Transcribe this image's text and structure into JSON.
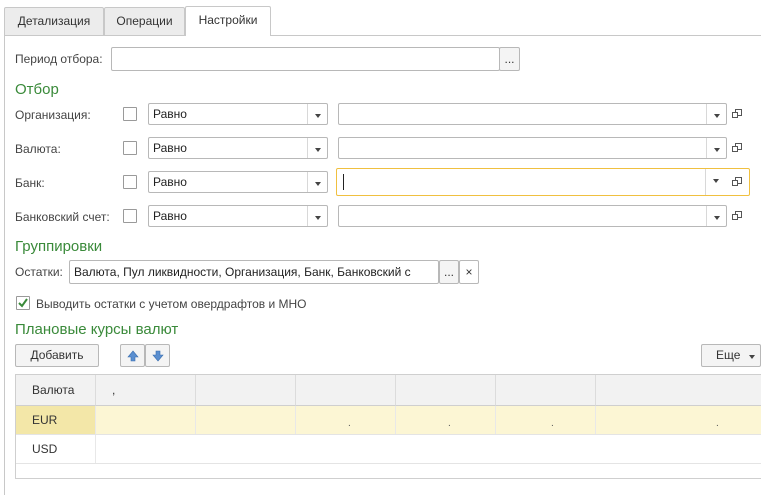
{
  "tabs": [
    {
      "label": "Детализация"
    },
    {
      "label": "Операции"
    },
    {
      "label": "Настройки"
    }
  ],
  "period": {
    "label": "Период отбора:",
    "value": "",
    "btn": "..."
  },
  "filter": {
    "title": "Отбор",
    "rows": [
      {
        "label": "Организация:",
        "condition": "Равно",
        "value": ""
      },
      {
        "label": "Валюта:",
        "condition": "Равно",
        "value": ""
      },
      {
        "label": "Банк:",
        "condition": "Равно",
        "value": ""
      },
      {
        "label": "Банковский счет:",
        "condition": "Равно",
        "value": ""
      }
    ]
  },
  "grouping": {
    "title": "Группировки",
    "label": "Остатки:",
    "value": "Валюта, Пул ликвидности, Организация, Банк, Банковский с",
    "btn": "...",
    "clear": "×"
  },
  "overdraft": {
    "checked": true,
    "label": "Выводить остатки с учетом овердрафтов и МНО"
  },
  "rates": {
    "title": "Плановые курсы валют",
    "add": "Добавить",
    "more": "Еще",
    "columns": [
      "Валюта",
      ",",
      "",
      "",
      "",
      "",
      ""
    ],
    "rows": [
      {
        "currency": "EUR",
        "cells": [
          "",
          ".",
          ".",
          ".",
          "."
        ]
      },
      {
        "currency": "USD",
        "cells": [
          "",
          "",
          "",
          "",
          ""
        ]
      }
    ]
  },
  "colors": {
    "accent": "#3a8a3a",
    "selection": "#fcf6d4",
    "focus": "#f0c040"
  }
}
